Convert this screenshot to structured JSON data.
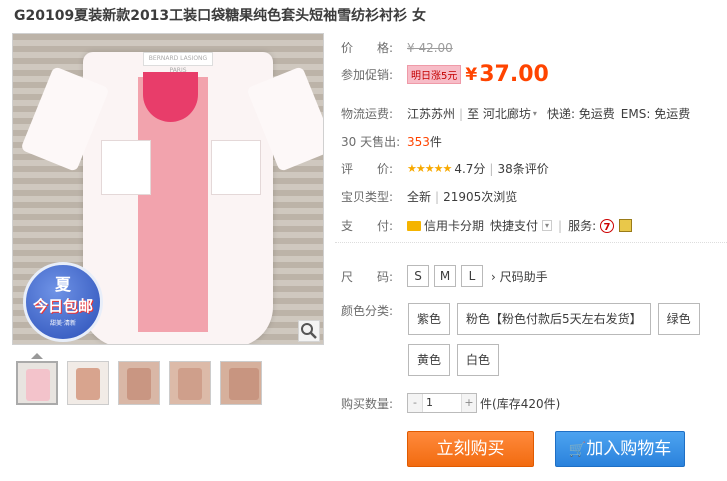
{
  "product": {
    "title": "G20109夏装新款2013工装口袋糖果纯色套头短袖雪纺衫衬衫 女",
    "collar_label": "BERNARD LASIONG PARIS",
    "badge": {
      "line1": "夏",
      "line2": "今日包邮",
      "line3": "甜美·清新"
    }
  },
  "info": {
    "price_label": "价　　格:",
    "old_price": "¥ 42.00",
    "promo_label": "参加促销:",
    "promo_tag": "明日涨5元",
    "currency": "¥",
    "price": "37.00",
    "shipping_label": "物流运费:",
    "shipping_from": "江苏苏州",
    "shipping_to_word": "至",
    "shipping_to": "河北廊坊",
    "shipping_express": "快递: 免运费",
    "shipping_ems": "EMS: 免运费",
    "sold_label": "30 天售出:",
    "sold_count": "353",
    "sold_unit": "件",
    "rating_label": "评　　价:",
    "rating_stars": "★★★★★",
    "rating_score": "4.7分",
    "rating_reviews": "38条评价",
    "type_label": "宝贝类型:",
    "type_value": "全新",
    "views": "21905次浏览",
    "pay_label": "支　　付:",
    "pay_credit": "信用卡分期",
    "pay_quick": "快捷支付",
    "service_label": "服务:"
  },
  "options": {
    "size_label": "尺　　码:",
    "sizes": [
      "S",
      "M",
      "L"
    ],
    "size_help": "尺码助手",
    "color_label": "颜色分类:",
    "colors": [
      "紫色",
      "粉色【粉色付款后5天左右发货】",
      "绿色",
      "黄色",
      "白色"
    ],
    "qty_label": "购买数量:",
    "qty_minus": "-",
    "qty_value": "1",
    "qty_plus": "+",
    "qty_unit": "件",
    "stock": "(库存420件)"
  },
  "actions": {
    "buy_now": "立刻购买",
    "add_cart": "加入购物车"
  },
  "colors": {
    "price_orange": "#ff4400",
    "buy_button": "#f26b10",
    "cart_button": "#2a82dc"
  }
}
